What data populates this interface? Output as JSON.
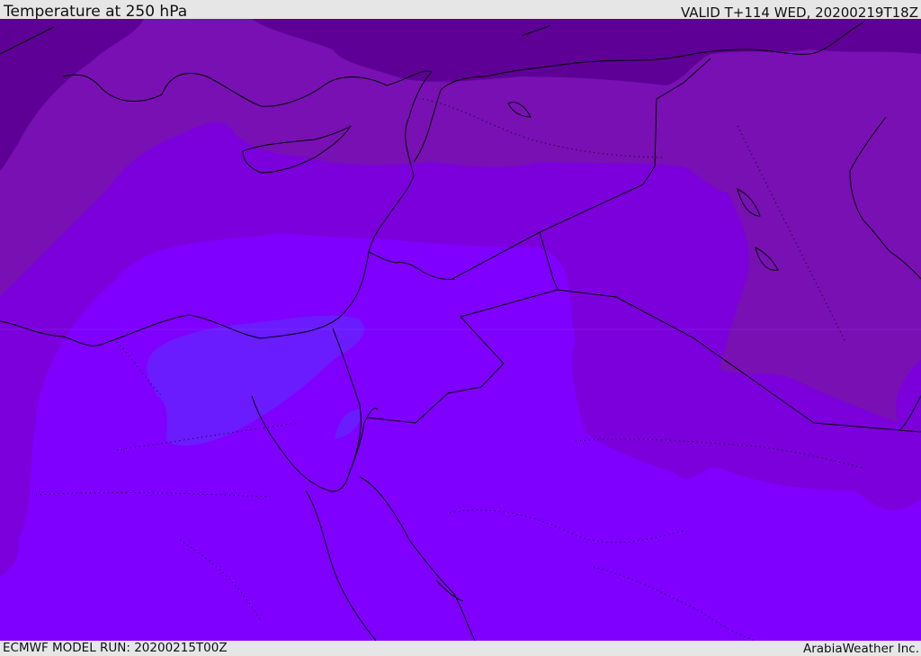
{
  "header": {
    "title": "Temperature at 250 hPa",
    "valid": "VALID T+114 WED, 20200219T18Z"
  },
  "footer": {
    "model_run": "ECMWF MODEL RUN: 20200215T00Z",
    "credit": "ArabiaWeather Inc."
  },
  "colors": {
    "band_coldest": "#5e0096",
    "band_cold": "#7810b4",
    "band_mid": "#7b00db",
    "band_warm": "#7f00ff",
    "band_warmest": "#6a1cff",
    "coastline": "#000000"
  }
}
